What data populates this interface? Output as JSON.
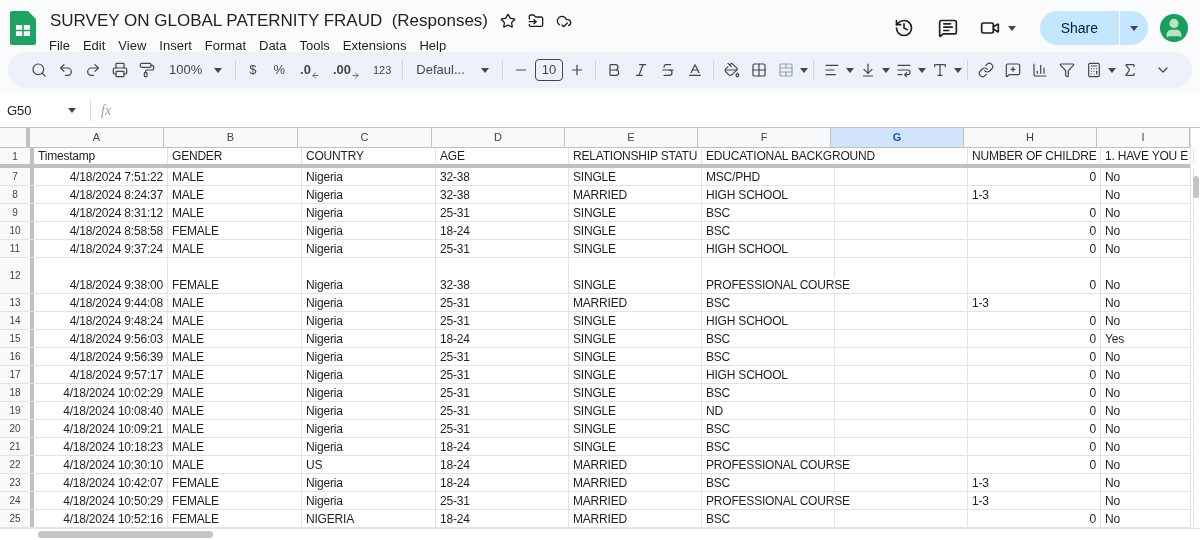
{
  "document": {
    "title": "SURVEY ON GLOBAL PATERNITY FRAUD  (Responses)"
  },
  "menu": [
    "File",
    "Edit",
    "View",
    "Insert",
    "Format",
    "Data",
    "Tools",
    "Extensions",
    "Help"
  ],
  "share_button": {
    "label": "Share"
  },
  "toolbar": {
    "zoom": "100%",
    "currency": "$",
    "percent": "%",
    "decrease_decimals": ".0",
    "increase_decimals": ".00",
    "number_format": "123",
    "font": "Defaul...",
    "font_size": "10"
  },
  "name_box": "G50",
  "formula_bar": {
    "label": "fx"
  },
  "columns": [
    {
      "label": "A",
      "selected": false
    },
    {
      "label": "B",
      "selected": false
    },
    {
      "label": "C",
      "selected": false
    },
    {
      "label": "D",
      "selected": false
    },
    {
      "label": "E",
      "selected": false
    },
    {
      "label": "F",
      "selected": false
    },
    {
      "label": "G",
      "selected": true
    },
    {
      "label": "H",
      "selected": false
    },
    {
      "label": "I",
      "selected": false
    }
  ],
  "header_row": {
    "number": "1",
    "cells": [
      "Timestamp",
      "GENDER",
      "COUNTRY",
      "AGE",
      "RELATIONSHIP STATU",
      "EDUCATIONAL BACKGROUND",
      "",
      "NUMBER OF CHILDRE",
      "1. HAVE YOU E"
    ]
  },
  "rows": [
    {
      "number": "7",
      "tall": false,
      "timestamp": "4/18/2024 7:51:22",
      "gender": "MALE",
      "country": "Nigeria",
      "age": "32-38",
      "status": "SINGLE",
      "education": "MSC/PHD",
      "children": {
        "text": "0",
        "numeric": true
      },
      "answer": "No"
    },
    {
      "number": "8",
      "tall": false,
      "timestamp": "4/18/2024 8:24:37",
      "gender": "MALE",
      "country": "Nigeria",
      "age": "32-38",
      "status": "MARRIED",
      "education": "HIGH SCHOOL",
      "children": {
        "text": "1-3",
        "numeric": false
      },
      "answer": "No"
    },
    {
      "number": "9",
      "tall": false,
      "timestamp": "4/18/2024 8:31:12",
      "gender": "MALE",
      "country": "Nigeria",
      "age": "25-31",
      "status": "SINGLE",
      "education": "BSC",
      "children": {
        "text": "0",
        "numeric": true
      },
      "answer": "No"
    },
    {
      "number": "10",
      "tall": false,
      "timestamp": "4/18/2024 8:58:58",
      "gender": "FEMALE",
      "country": "Nigeria",
      "age": "18-24",
      "status": "SINGLE",
      "education": "BSC",
      "children": {
        "text": "0",
        "numeric": true
      },
      "answer": "No"
    },
    {
      "number": "11",
      "tall": false,
      "timestamp": "4/18/2024 9:37:24",
      "gender": "MALE",
      "country": "Nigeria",
      "age": "25-31",
      "status": "SINGLE",
      "education": "HIGH SCHOOL",
      "children": {
        "text": "0",
        "numeric": true
      },
      "answer": "No"
    },
    {
      "number": "12",
      "tall": true,
      "timestamp": "4/18/2024 9:38:00",
      "gender": "FEMALE",
      "country": "Nigeria",
      "age": "32-38",
      "status": "SINGLE",
      "education": "PROFESSIONAL COURSE",
      "children": {
        "text": "0",
        "numeric": true
      },
      "answer": "No"
    },
    {
      "number": "13",
      "tall": false,
      "timestamp": "4/18/2024 9:44:08",
      "gender": "MALE",
      "country": "Nigeria",
      "age": "25-31",
      "status": "MARRIED",
      "education": "BSC",
      "children": {
        "text": "1-3",
        "numeric": false
      },
      "answer": "No"
    },
    {
      "number": "14",
      "tall": false,
      "timestamp": "4/18/2024 9:48:24",
      "gender": "MALE",
      "country": "Nigeria",
      "age": "25-31",
      "status": "SINGLE",
      "education": "HIGH SCHOOL",
      "children": {
        "text": "0",
        "numeric": true
      },
      "answer": "No"
    },
    {
      "number": "15",
      "tall": false,
      "timestamp": "4/18/2024 9:56:03",
      "gender": "MALE",
      "country": "Nigeria",
      "age": "18-24",
      "status": "SINGLE",
      "education": "BSC",
      "children": {
        "text": "0",
        "numeric": true
      },
      "answer": "Yes"
    },
    {
      "number": "16",
      "tall": false,
      "timestamp": "4/18/2024 9:56:39",
      "gender": "MALE",
      "country": "Nigeria",
      "age": "25-31",
      "status": "SINGLE",
      "education": "BSC",
      "children": {
        "text": "0",
        "numeric": true
      },
      "answer": "No"
    },
    {
      "number": "17",
      "tall": false,
      "timestamp": "4/18/2024 9:57:17",
      "gender": "MALE",
      "country": "Nigeria",
      "age": "25-31",
      "status": "SINGLE",
      "education": "HIGH SCHOOL",
      "children": {
        "text": "0",
        "numeric": true
      },
      "answer": "No"
    },
    {
      "number": "18",
      "tall": false,
      "timestamp": "4/18/2024 10:02:29",
      "gender": "MALE",
      "country": "Nigeria",
      "age": "25-31",
      "status": "SINGLE",
      "education": "BSC",
      "children": {
        "text": "0",
        "numeric": true
      },
      "answer": "No"
    },
    {
      "number": "19",
      "tall": false,
      "timestamp": "4/18/2024 10:08:40",
      "gender": "MALE",
      "country": "Nigeria",
      "age": "25-31",
      "status": "SINGLE",
      "education": "ND",
      "children": {
        "text": "0",
        "numeric": true
      },
      "answer": "No"
    },
    {
      "number": "20",
      "tall": false,
      "timestamp": "4/18/2024 10:09:21",
      "gender": "MALE",
      "country": "Nigeria",
      "age": "25-31",
      "status": "SINGLE",
      "education": "BSC",
      "children": {
        "text": "0",
        "numeric": true
      },
      "answer": "No"
    },
    {
      "number": "21",
      "tall": false,
      "timestamp": "4/18/2024 10:18:23",
      "gender": "MALE",
      "country": "Nigeria",
      "age": "18-24",
      "status": "SINGLE",
      "education": "BSC",
      "children": {
        "text": "0",
        "numeric": true
      },
      "answer": "No"
    },
    {
      "number": "22",
      "tall": false,
      "timestamp": "4/18/2024 10:30:10",
      "gender": "MALE",
      "country": "US",
      "age": "18-24",
      "status": "MARRIED",
      "education": "PROFESSIONAL COURSE",
      "children": {
        "text": "0",
        "numeric": true
      },
      "answer": "No"
    },
    {
      "number": "23",
      "tall": false,
      "timestamp": "4/18/2024 10:42:07",
      "gender": "FEMALE",
      "country": "Nigeria",
      "age": "18-24",
      "status": "MARRIED",
      "education": "BSC",
      "children": {
        "text": "1-3",
        "numeric": false
      },
      "answer": "No"
    },
    {
      "number": "24",
      "tall": false,
      "timestamp": "4/18/2024 10:50:29",
      "gender": "FEMALE",
      "country": "Nigeria",
      "age": "25-31",
      "status": "MARRIED",
      "education": "PROFESSIONAL COURSE",
      "children": {
        "text": "1-3",
        "numeric": false
      },
      "answer": "No"
    },
    {
      "number": "25",
      "tall": false,
      "timestamp": "4/18/2024 10:52:16",
      "gender": "FEMALE",
      "country": "NIGERIA",
      "age": "18-24",
      "status": "MARRIED",
      "education": "BSC",
      "children": {
        "text": "0",
        "numeric": true
      },
      "answer": "No"
    }
  ]
}
